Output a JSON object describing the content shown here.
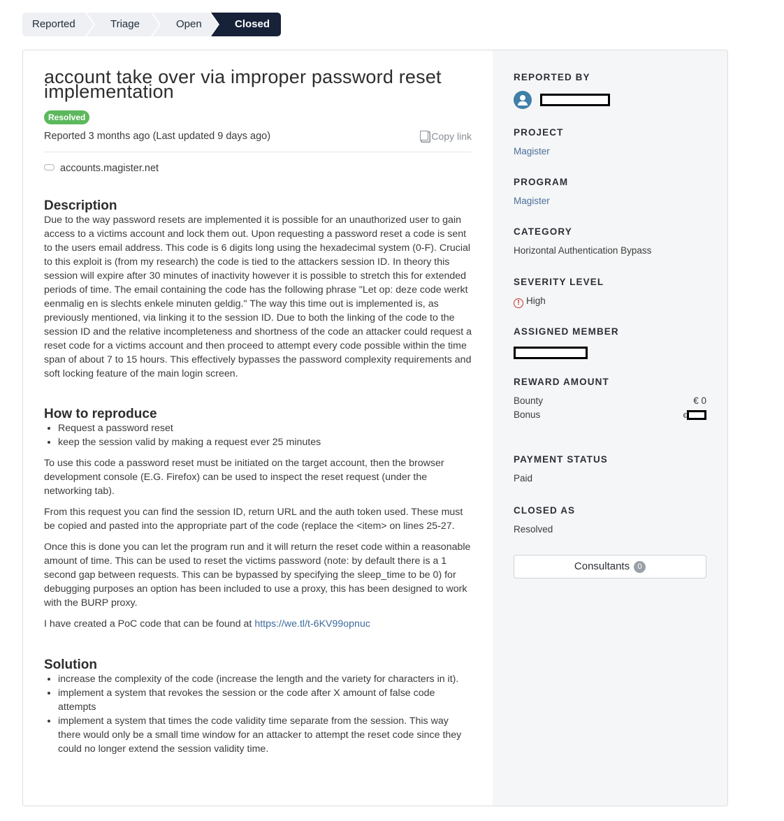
{
  "steps": [
    "Reported",
    "Triage",
    "Open",
    "Closed"
  ],
  "report": {
    "title": "account take over via improper password reset implementation",
    "status_badge": "Resolved",
    "reported_text": "Reported 3 months ago (Last updated 9 days ago)",
    "copy_link": "Copy link",
    "asset": "accounts.magister.net"
  },
  "description": {
    "heading": "Description",
    "text": "Due to the way password resets are implemented it is possible for an unauthorized user to gain access to a victims account and lock them out. Upon requesting a password reset a code is sent to the users email address. This code is 6 digits long using the hexadecimal system (0-F). Crucial to this exploit is (from my research) the code is tied to the attackers session ID. In theory this session will expire after 30 minutes of inactivity however it is possible to stretch this for extended periods of time. The email containing the code has the following phrase \"Let op: deze code werkt eenmalig en is slechts enkele minuten geldig.\" The way this time out is implemented is, as previously mentioned, via linking it to the session ID. Due to both the linking of the code to the session ID and the relative incompleteness and shortness of the code an attacker could request a reset code for a victims account and then proceed to attempt every code possible within the time span of about 7 to 15 hours. This effectively bypasses the password complexity requirements and soft locking feature of the main login screen."
  },
  "reproduce": {
    "heading": "How to reproduce",
    "items": [
      "Request a password reset",
      "keep the session valid by making a request ever 25 minutes"
    ],
    "p1": "To use this code a password reset must be initiated on the target account, then the browser development console (E.G. Firefox) can be used to inspect the reset request (under the networking tab).",
    "p2": "From this request you can find the session ID, return URL and the auth token used. These must be copied and pasted into the appropriate part of the code (replace the <item> on lines 25-27.",
    "p3": "Once this is done you can let the program run and it will return the reset code within a reasonable amount of time. This can be used to reset the victims password (note: by default there is a 1 second gap between requests. This can be bypassed by specifying the sleep_time to be 0) for debugging purposes an option has been included to use a proxy, this has been designed to work with the BURP proxy.",
    "p4_prefix": "I have created a PoC code that can be found at ",
    "p4_link": "https://we.tl/t-6KV99opnuc"
  },
  "solution": {
    "heading": "Solution",
    "items": [
      "increase the complexity of the code (increase the length and the variety for characters in it).",
      "implement a system that revokes the session or the code after X amount of false code attempts",
      "implement a system that times the code validity time separate from the session. This way there would only be a small time window for an attacker to attempt the reset code since they could no longer extend the session validity time."
    ]
  },
  "sidebar": {
    "reported_by_label": "REPORTED BY",
    "project_label": "PROJECT",
    "project": "Magister",
    "program_label": "PROGRAM",
    "program": "Magister",
    "category_label": "CATEGORY",
    "category": "Horizontal Authentication Bypass",
    "severity_label": "SEVERITY LEVEL",
    "severity": "High",
    "severity_icon": "!",
    "assigned_label": "ASSIGNED MEMBER",
    "reward_label": "REWARD AMOUNT",
    "bounty_label": "Bounty",
    "bounty_value": "€ 0",
    "bonus_label": "Bonus",
    "bonus_currency": "€",
    "payment_label": "PAYMENT STATUS",
    "payment": "Paid",
    "closed_as_label": "CLOSED AS",
    "closed_as": "Resolved",
    "consultants_label": "Consultants",
    "consultants_count": "0"
  }
}
